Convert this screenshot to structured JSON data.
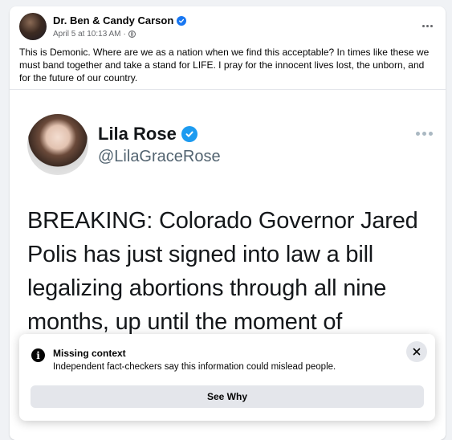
{
  "post": {
    "author": "Dr. Ben & Candy Carson",
    "timestamp": "April 5 at 10:13 AM",
    "separator": "·",
    "text": "This is Demonic. Where are we as a nation when we find this acceptable? In times like these we must band together and take a stand for LIFE. I pray for the innocent lives lost, the unborn, and for the future of our country."
  },
  "tweet": {
    "name": "Lila Rose",
    "handle": "@LilaGraceRose",
    "text": "BREAKING: Colorado Governor Jared Polis has just signed into law a bill legalizing abortions through all nine months, up until the moment of"
  },
  "fact_check": {
    "title": "Missing context",
    "description": "Independent fact-checkers say this information could mislead people.",
    "button_label": "See Why",
    "info_glyph": "i"
  },
  "colors": {
    "verified_blue": "#1877f2",
    "twitter_blue": "#1d9bf0",
    "background": "#f0f2f5"
  },
  "icons": {
    "verified": "verified-badge-icon",
    "privacy": "globe-icon",
    "more": "more-options-icon",
    "info": "info-icon",
    "close": "close-icon"
  }
}
